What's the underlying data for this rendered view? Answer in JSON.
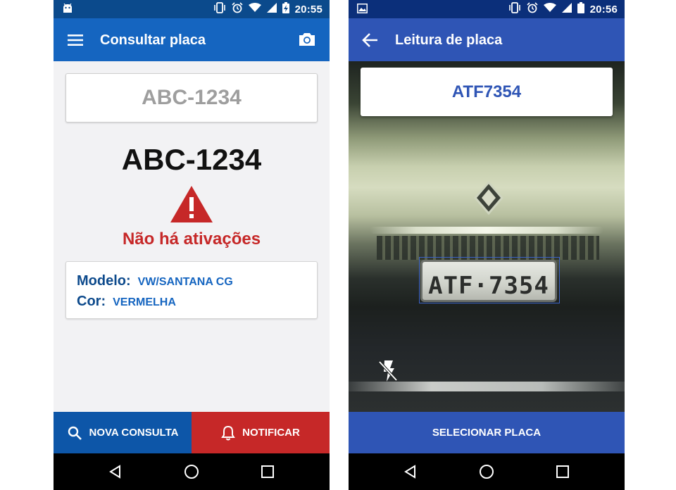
{
  "colors": {
    "primary": "#1565c0",
    "primary_dark": "#0b4a8c",
    "danger": "#c62828",
    "secondary_bar": "#2f55b5"
  },
  "left_screen": {
    "status_bar": {
      "time": "20:55",
      "left_icon": "android-icon",
      "icons": [
        "vibrate-icon",
        "alarm-icon",
        "wifi-icon",
        "signal-icon",
        "battery-charging-icon"
      ]
    },
    "app_bar": {
      "title": "Consultar placa",
      "nav_icon": "menu-icon",
      "action_icon": "camera-icon"
    },
    "plate_input": {
      "value": "",
      "placeholder": "ABC-1234"
    },
    "plate_display": "ABC-1234",
    "alert_icon": "warning-icon",
    "status_message": "Não há ativações",
    "vehicle_info": {
      "model_label": "Modelo:",
      "model_value": "VW/SANTANA CG",
      "color_label": "Cor:",
      "color_value": "VERMELHA"
    },
    "buttons": {
      "new_query": {
        "label": "NOVA CONSULTA",
        "icon": "search-icon"
      },
      "notify": {
        "label": "NOTIFICAR",
        "icon": "bell-icon"
      }
    }
  },
  "right_screen": {
    "status_bar": {
      "time": "20:56",
      "left_icon": "image-icon",
      "icons": [
        "vibrate-icon",
        "alarm-icon",
        "wifi-icon",
        "signal-icon",
        "battery-icon"
      ]
    },
    "app_bar": {
      "title": "Leitura de placa",
      "nav_icon": "back-arrow-icon"
    },
    "recognized_plate": "ATF7354",
    "camera": {
      "plate_text": "ATF·7354",
      "flash_icon": "flash-off-icon"
    },
    "select_button": {
      "label": "SELECIONAR PLACA"
    }
  },
  "nav_bar": {
    "icons": [
      "back-triangle-icon",
      "home-circle-icon",
      "recents-square-icon"
    ]
  }
}
